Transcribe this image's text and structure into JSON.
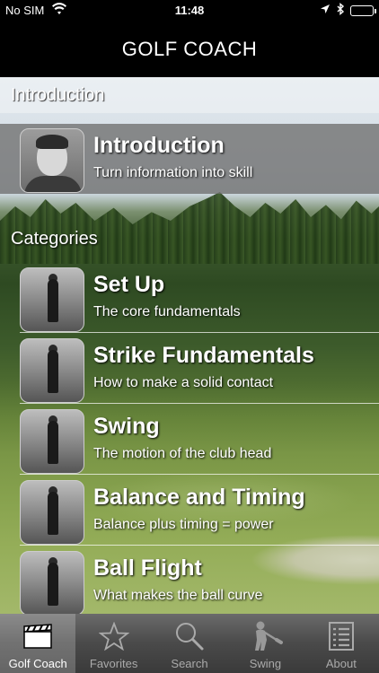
{
  "status_bar": {
    "carrier": "No SIM",
    "time": "11:48"
  },
  "nav": {
    "title": "GOLF COACH"
  },
  "sections": {
    "intro_header": "Introduction",
    "categories_header": "Categories"
  },
  "intro_item": {
    "title": "Introduction",
    "subtitle": "Turn information into skill"
  },
  "categories": [
    {
      "title": "Set Up",
      "subtitle": "The core fundamentals"
    },
    {
      "title": "Strike Fundamentals",
      "subtitle": "How to make a solid contact"
    },
    {
      "title": "Swing",
      "subtitle": "The motion of the club head"
    },
    {
      "title": "Balance and Timing",
      "subtitle": "Balance plus timing = power"
    },
    {
      "title": "Ball Flight",
      "subtitle": "What makes the ball curve"
    }
  ],
  "tabs": [
    {
      "label": "Golf Coach",
      "icon": "clapperboard-icon",
      "active": true
    },
    {
      "label": "Favorites",
      "icon": "star-icon",
      "active": false
    },
    {
      "label": "Search",
      "icon": "search-icon",
      "active": false
    },
    {
      "label": "Swing",
      "icon": "golfer-icon",
      "active": false
    },
    {
      "label": "About",
      "icon": "list-icon",
      "active": false
    }
  ]
}
